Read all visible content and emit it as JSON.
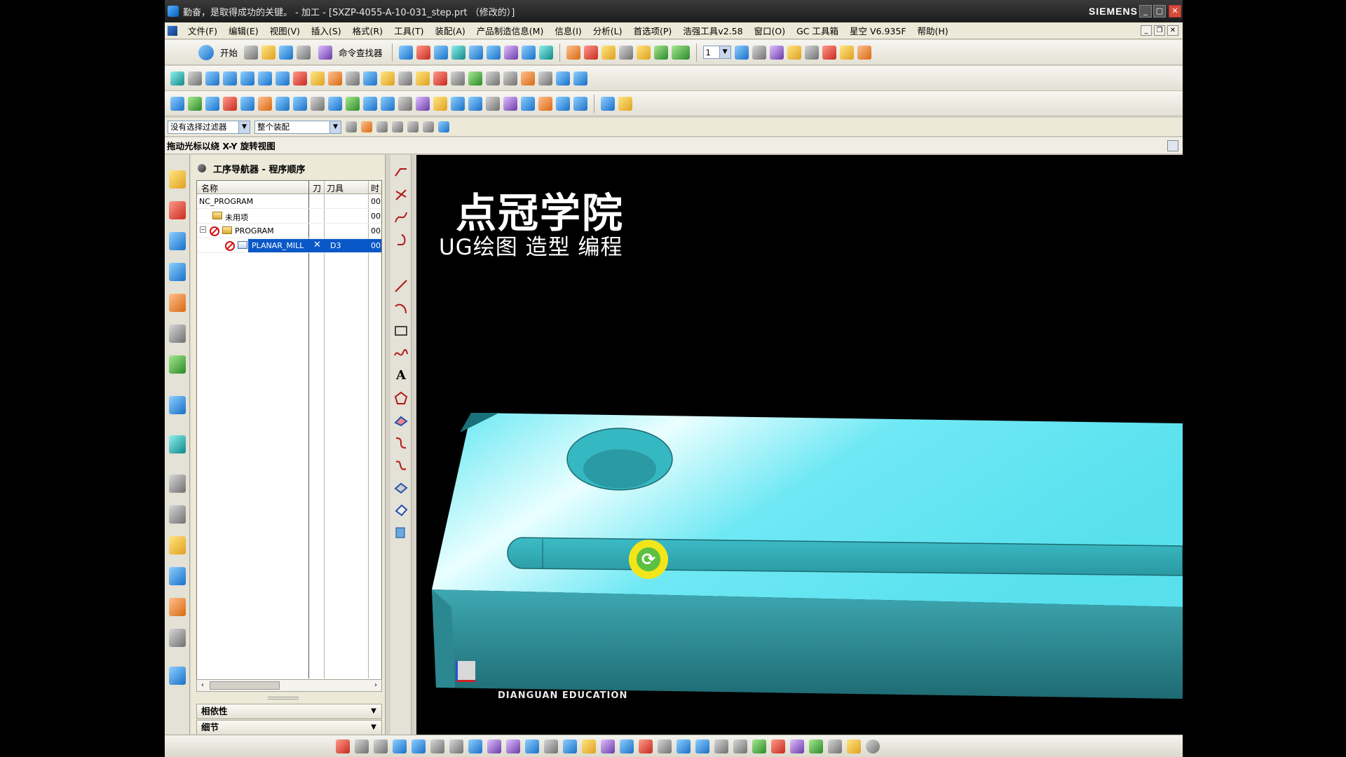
{
  "window": {
    "title": "勤奋，是取得成功的关键。 - 加工 - [SXZP-4055-A-10-031_step.prt （修改的）]",
    "brand": "SIEMENS"
  },
  "menu": {
    "items": [
      {
        "label": "文件(F)"
      },
      {
        "label": "编辑(E)"
      },
      {
        "label": "视图(V)"
      },
      {
        "label": "插入(S)"
      },
      {
        "label": "格式(R)"
      },
      {
        "label": "工具(T)"
      },
      {
        "label": "装配(A)"
      },
      {
        "label": "产品制造信息(M)"
      },
      {
        "label": "信息(I)"
      },
      {
        "label": "分析(L)"
      },
      {
        "label": "首选项(P)"
      },
      {
        "label": "浩强工具v2.58"
      },
      {
        "label": "窗口(O)"
      },
      {
        "label": "GC 工具箱"
      },
      {
        "label": "星空 V6.935F"
      },
      {
        "label": "帮助(H)"
      }
    ]
  },
  "toolbar": {
    "start_label": "开始",
    "command_finder_label": "命令查找器",
    "view_number": "1"
  },
  "selection": {
    "filter": "没有选择过滤器",
    "scope": "整个装配"
  },
  "hint": "拖动光标以绕 X-Y 旋转视图",
  "navigator": {
    "title": "工序导航器 - 程序顺序",
    "columns": [
      "名称",
      "刀",
      "刀具",
      "时"
    ],
    "rows": [
      {
        "name": "NC_PROGRAM",
        "tool": "",
        "time": "00:"
      },
      {
        "name": "未用项",
        "tool": "",
        "time": "00:"
      },
      {
        "name": "PROGRAM",
        "tool": "",
        "time": "00:"
      },
      {
        "name": "PLANAR_MILL",
        "tool": "D3",
        "time": "00:"
      }
    ],
    "sections": [
      "相依性",
      "细节"
    ]
  },
  "viewport": {
    "watermark_title": "点冠学院",
    "watermark_subtitle": "UG绘图 造型 编程",
    "watermark_footer": "DIANGUAN EDUCATION"
  },
  "colors": {
    "part_light": "#5ee6f2",
    "part_dark": "#2a8a94",
    "selection": "#0a58c8",
    "viewport_bg": "#000000"
  }
}
